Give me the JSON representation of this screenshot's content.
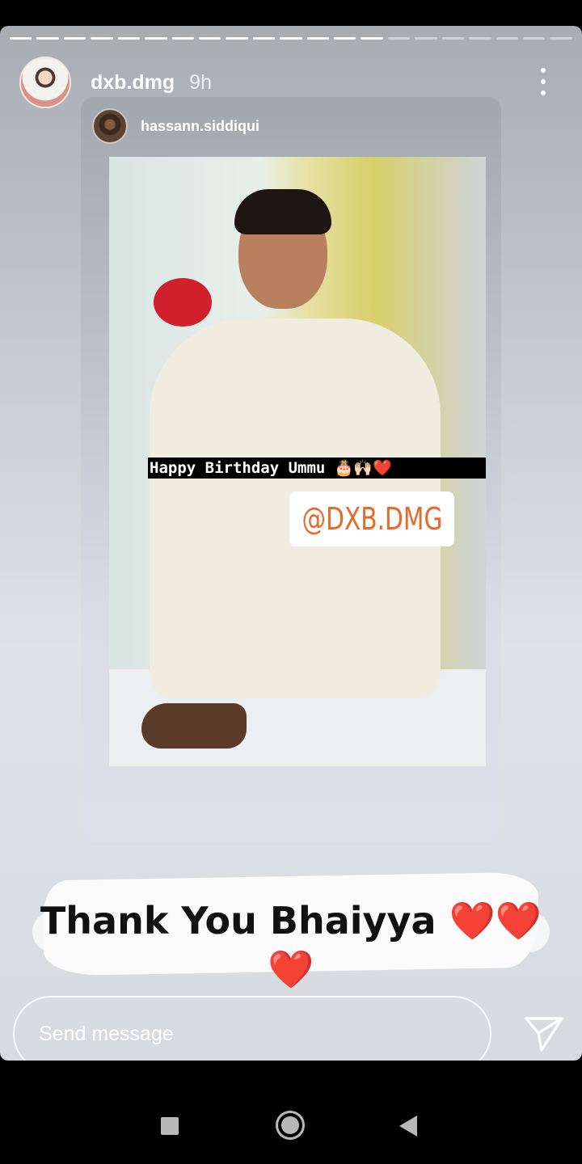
{
  "story": {
    "progress_total": 21,
    "progress_done": 14,
    "username": "dxb.dmg",
    "time": "9h"
  },
  "shared_post": {
    "username": "hassann.siddiqui",
    "caption": "Happy Birthday Ummu 🎂🙌🏻❤️",
    "mention": "@DXB.DMG"
  },
  "overlay_text": {
    "line1": "Thank You Bhaiyya",
    "line1_hearts": "❤️❤️",
    "line2_heart": "❤️"
  },
  "reply": {
    "placeholder": "Send message"
  },
  "icons": {
    "more": "more-vertical-icon",
    "send": "send-paper-plane-icon",
    "nav_recent": "square-icon",
    "nav_home": "circle-icon",
    "nav_back": "triangle-back-icon"
  },
  "colors": {
    "mention": "#e66a2e",
    "heart": "#e01b24"
  }
}
